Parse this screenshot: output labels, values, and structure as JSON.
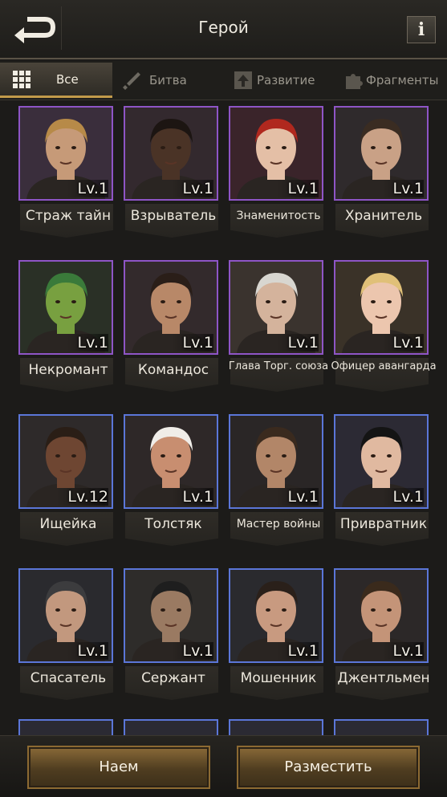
{
  "header": {
    "title": "Герой",
    "info_label": "i"
  },
  "tabs": [
    {
      "label": "Все",
      "active": true
    },
    {
      "label": "Битва",
      "active": false
    },
    {
      "label": "Развитие",
      "active": false
    },
    {
      "label": "Фрагменты",
      "active": false
    }
  ],
  "heroes": [
    {
      "name": "Страж тайн",
      "level": "Lv.1",
      "rarity": "purple",
      "skin": "#c69a78",
      "hair": "#b78a48",
      "bg": "#3a2e3c"
    },
    {
      "name": "Взрыватель",
      "level": "Lv.1",
      "rarity": "purple",
      "skin": "#4a3326",
      "hair": "#1c1512",
      "bg": "#33292e"
    },
    {
      "name": "Знаменитость",
      "level": "Lv.1",
      "rarity": "purple",
      "skin": "#e4bfa6",
      "hair": "#b0281e",
      "bg": "#3a242a"
    },
    {
      "name": "Хранитель",
      "level": "Lv.1",
      "rarity": "purple",
      "skin": "#c9a186",
      "hair": "#3a2c22",
      "bg": "#2f2a2c"
    },
    {
      "name": "Некромант",
      "level": "Lv.1",
      "rarity": "purple",
      "skin": "#78a040",
      "hair": "#3a7a3a",
      "bg": "#2a3026"
    },
    {
      "name": "Командос",
      "level": "Lv.1",
      "rarity": "purple",
      "skin": "#b88868",
      "hair": "#2a1e18",
      "bg": "#332a2c"
    },
    {
      "name": "Глава Торг. союза",
      "level": "Lv.1",
      "rarity": "purple",
      "skin": "#d4b39c",
      "hair": "#d8d6d0",
      "bg": "#3a332e"
    },
    {
      "name": "Офицер авангарда",
      "level": "Lv.1",
      "rarity": "purple",
      "skin": "#ecc6ae",
      "hair": "#e0c078",
      "bg": "#3a3228"
    },
    {
      "name": "Ищейка",
      "level": "Lv.12",
      "rarity": "blue",
      "skin": "#6e4632",
      "hair": "#2a1e16",
      "bg": "#2e2a2a"
    },
    {
      "name": "Толстяк",
      "level": "Lv.1",
      "rarity": "blue",
      "skin": "#c88e70",
      "hair": "#f0ede8",
      "bg": "#2e2828"
    },
    {
      "name": "Мастер войны",
      "level": "Lv.1",
      "rarity": "blue",
      "skin": "#b28668",
      "hair": "#3a2a1e",
      "bg": "#2a2626"
    },
    {
      "name": "Привратник",
      "level": "Lv.1",
      "rarity": "blue",
      "skin": "#e0b9a0",
      "hair": "#141414",
      "bg": "#2c2a34"
    },
    {
      "name": "Спасатель",
      "level": "Lv.1",
      "rarity": "blue",
      "skin": "#c2987e",
      "hair": "#3c3c3e",
      "bg": "#2a2a2e"
    },
    {
      "name": "Сержант",
      "level": "Lv.1",
      "rarity": "blue",
      "skin": "#9a7a62",
      "hair": "#1e1e1e",
      "bg": "#2e2c2a"
    },
    {
      "name": "Мошенник",
      "level": "Lv.1",
      "rarity": "blue",
      "skin": "#c89a80",
      "hair": "#2a201a",
      "bg": "#2a2a2e"
    },
    {
      "name": "Джентльмен",
      "level": "Lv.1",
      "rarity": "blue",
      "skin": "#c49478",
      "hair": "#3a2a1c",
      "bg": "#2c2828"
    }
  ],
  "footer": {
    "hire_label": "Наем",
    "place_label": "Разместить"
  },
  "colors": {
    "accent_gold": "#c29a4a",
    "rarity_purple": "#8e55c6",
    "rarity_blue": "#5b76d8"
  }
}
